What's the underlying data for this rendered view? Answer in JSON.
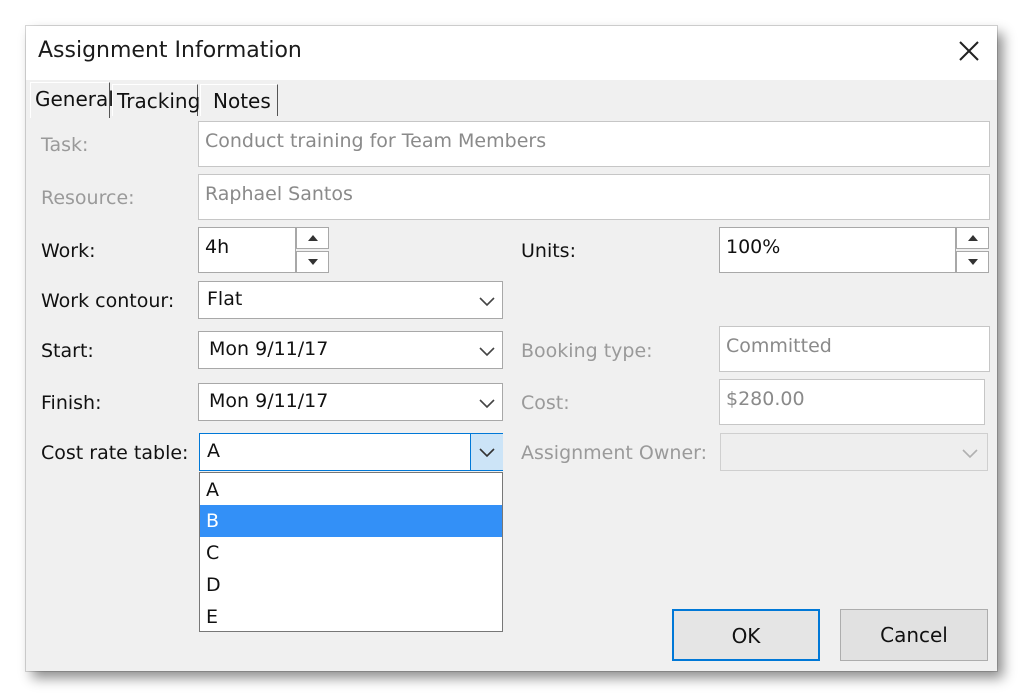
{
  "dialog": {
    "title": "Assignment Information",
    "close_icon": "close-icon"
  },
  "tabs": [
    {
      "label": "General",
      "active": true
    },
    {
      "label": "Tracking",
      "active": false
    },
    {
      "label": "Notes",
      "active": false
    }
  ],
  "fields": {
    "task": {
      "label": "Task:",
      "value": "Conduct training for Team Members",
      "enabled": false
    },
    "resource": {
      "label": "Resource:",
      "value": "Raphael Santos",
      "enabled": false
    },
    "work": {
      "label": "Work:",
      "value": "4h"
    },
    "units": {
      "label": "Units:",
      "value": "100%"
    },
    "work_contour": {
      "label": "Work contour:",
      "value": "Flat"
    },
    "start": {
      "label": "Start:",
      "value": "Mon 9/11/17"
    },
    "finish": {
      "label": "Finish:",
      "value": "Mon 9/11/17"
    },
    "booking_type": {
      "label": "Booking type:",
      "value": "Committed",
      "enabled": false
    },
    "cost": {
      "label": "Cost:",
      "value": "$280.00",
      "enabled": false
    },
    "cost_rate_table": {
      "label": "Cost rate table:",
      "value": "A",
      "open": true
    },
    "assignment_owner": {
      "label": "Assignment Owner:",
      "value": "",
      "enabled": false
    }
  },
  "cost_rate_options": [
    {
      "label": "A",
      "selected": false
    },
    {
      "label": "B",
      "selected": true
    },
    {
      "label": "C",
      "selected": false
    },
    {
      "label": "D",
      "selected": false
    },
    {
      "label": "E",
      "selected": false
    }
  ],
  "buttons": {
    "ok": "OK",
    "cancel": "Cancel"
  },
  "colors": {
    "highlight": "#3390f7",
    "focus_border": "#0078d7",
    "dialog_bg": "#f0f0f0",
    "disabled_text": "#9a9a9a"
  }
}
